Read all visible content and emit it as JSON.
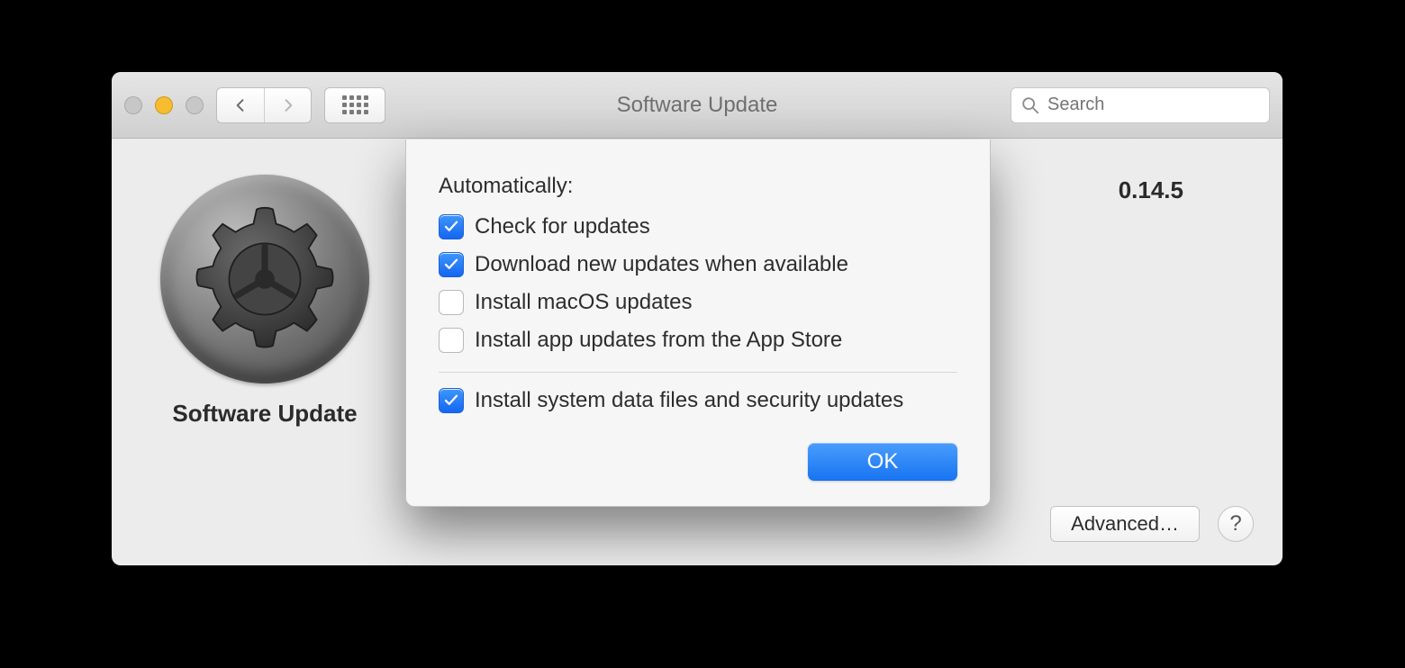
{
  "window": {
    "title": "Software Update"
  },
  "toolbar": {
    "search_placeholder": "Search"
  },
  "left": {
    "icon_caption": "Software Update"
  },
  "background": {
    "version_fragment": "0.14.5"
  },
  "footer": {
    "advanced_label": "Advanced…",
    "help_label": "?"
  },
  "sheet": {
    "heading": "Automatically:",
    "options": [
      {
        "label": "Check for updates",
        "checked": true
      },
      {
        "label": "Download new updates when available",
        "checked": true
      },
      {
        "label": "Install macOS updates",
        "checked": false
      },
      {
        "label": "Install app updates from the App Store",
        "checked": false
      }
    ],
    "security_option": {
      "label": "Install system data files and security updates",
      "checked": true
    },
    "ok_label": "OK"
  }
}
